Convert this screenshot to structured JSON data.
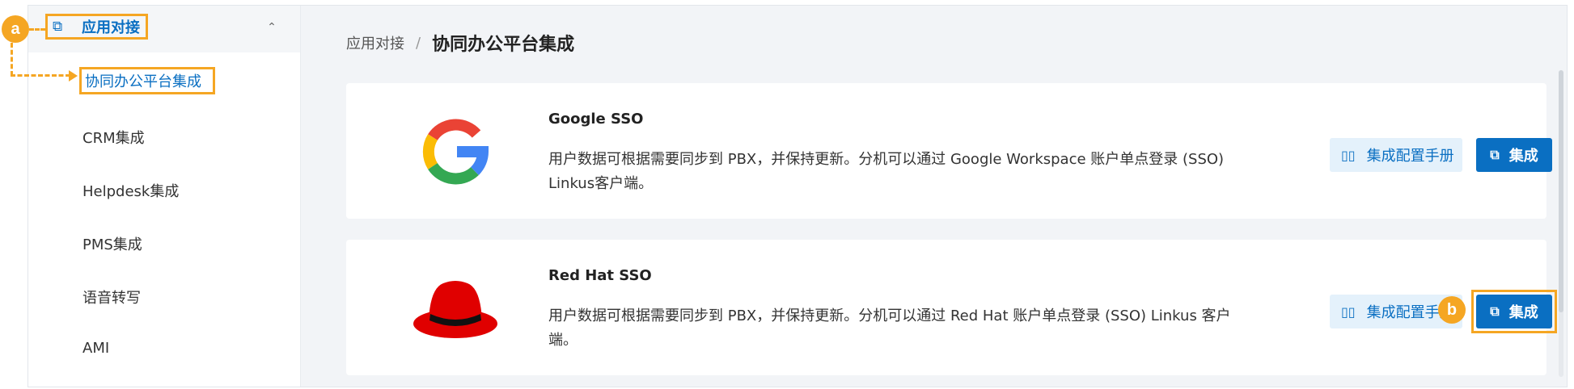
{
  "sidebar": {
    "group_label": "应用对接",
    "active_item": "协同办公平台集成",
    "items": [
      "CRM集成",
      "Helpdesk集成",
      "PMS集成",
      "语音转写",
      "AMI"
    ]
  },
  "annotations": {
    "a": "a",
    "b": "b"
  },
  "breadcrumb": {
    "parent": "应用对接",
    "separator": "/",
    "current": "协同办公平台集成"
  },
  "cards": [
    {
      "title": "Google SSO",
      "desc_line1": "用户数据可根据需要同步到 PBX，并保持更新。分机可以通过 Google Workspace 账户单点登录 (SSO)",
      "desc_line2": "Linkus客户端。",
      "manual_label": "集成配置手册",
      "integrate_label": "集成"
    },
    {
      "title": "Red Hat SSO",
      "desc_line1": "用户数据可根据需要同步到 PBX，并保持更新。分机可以通过 Red Hat 账户单点登录 (SSO) Linkus 客户",
      "desc_line2": "端。",
      "manual_label": "集成配置手册",
      "integrate_label": "集成"
    }
  ],
  "colors": {
    "accent": "#0a6fc2",
    "highlight": "#f5a623",
    "background": "#f2f4f7"
  },
  "icons": {
    "group": "copy-icon",
    "chevron": "chevron-up-icon",
    "manual": "book-icon",
    "integrate": "copy-icon"
  }
}
